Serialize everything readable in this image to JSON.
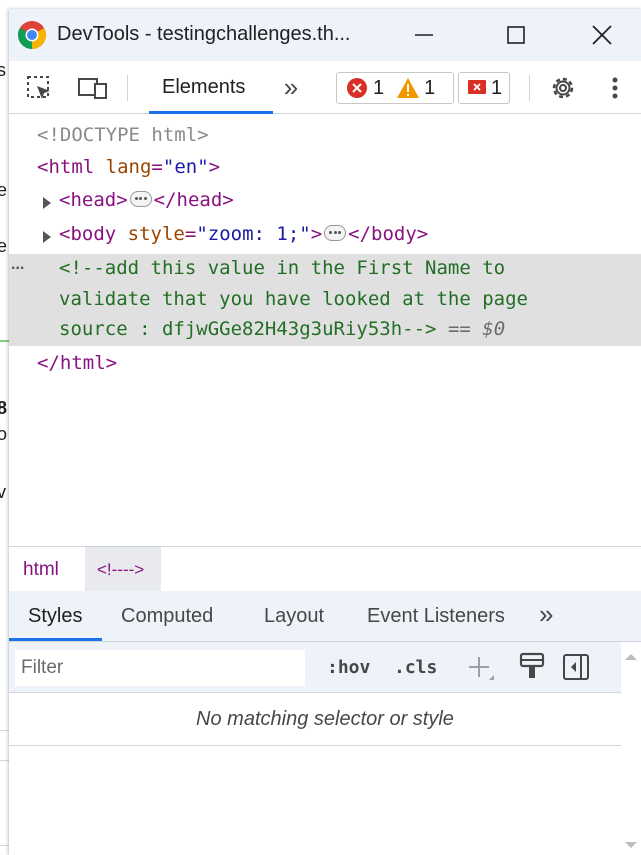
{
  "window": {
    "title": "DevTools - testingchallenges.th..."
  },
  "toolbar": {
    "elements_tab": "Elements",
    "more_tabs": "»",
    "errors_count": "1",
    "warnings_count": "1",
    "issues_count": "1"
  },
  "elements_tree": {
    "doctype": "<!DOCTYPE html>",
    "html_open": "<html",
    "html_lang_attr": "lang",
    "html_lang_val": "\"en\"",
    "head_open": "<head>",
    "head_close": "</head>",
    "body_open": "<body",
    "body_style_attr": "style",
    "body_style_val": "\"zoom: 1;\"",
    "body_close": "</body>",
    "comment_line1": "<!--add this value in the First Name to",
    "comment_line2": "validate that you have looked at the page",
    "comment_line3": "source : dfjwGGe82H43g3uRiy53h-->",
    "selected_marker": "== $0",
    "html_close": "</html>",
    "row_dots": "..."
  },
  "breadcrumb": {
    "html": "html",
    "comment": "<!---->"
  },
  "styles_tabs": [
    "Styles",
    "Computed",
    "Layout",
    "Event Listeners",
    "»"
  ],
  "filter": {
    "placeholder": "Filter",
    "hov": ":hov",
    "cls": ".cls"
  },
  "styles_empty": "No matching selector or style",
  "colors": {
    "accent": "#1a73e8",
    "error": "#d93025",
    "warning": "#f29900",
    "tag": "#881280",
    "comment": "#236e25"
  }
}
